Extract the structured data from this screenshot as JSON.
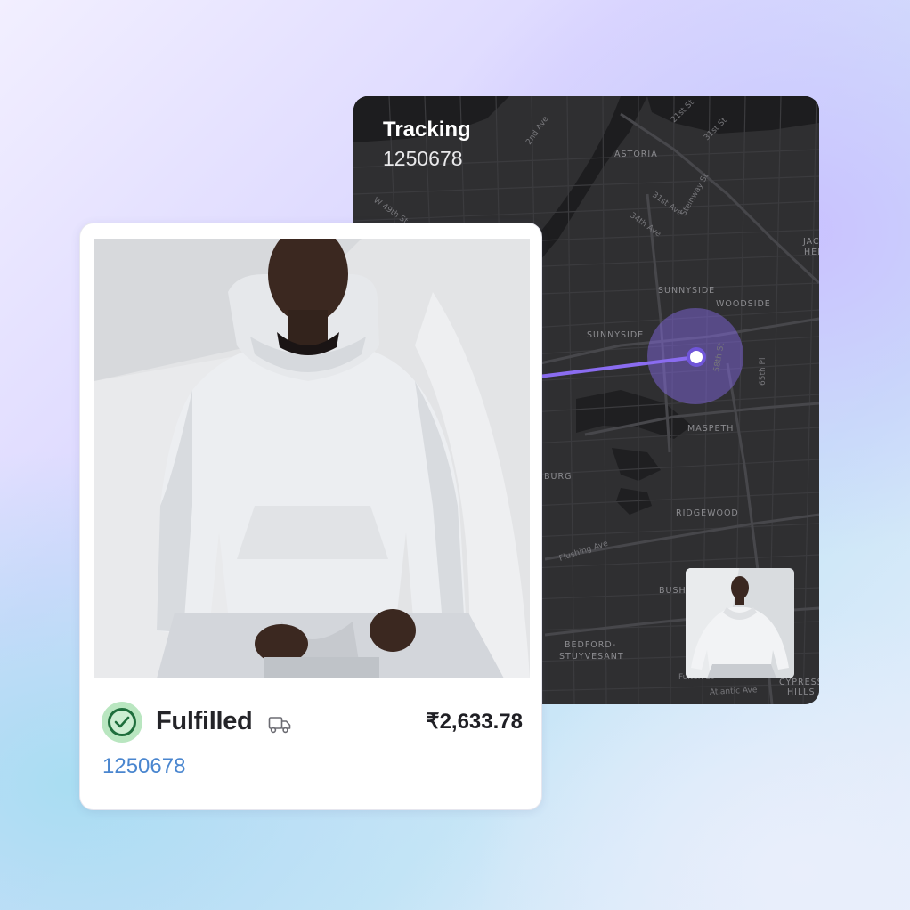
{
  "tracking": {
    "title": "Tracking",
    "number": "1250678"
  },
  "map": {
    "neighborhoods": [
      {
        "label": "ASTORIA"
      },
      {
        "label": "SUNNYSIDE"
      },
      {
        "label": "WOODSIDE"
      },
      {
        "label": "SUNNYSIDE"
      },
      {
        "label": "MASPETH"
      },
      {
        "label": "RIDGEWOOD"
      },
      {
        "label": "BURG"
      },
      {
        "label": "BEDFORD-"
      },
      {
        "label": "STUYVESANT"
      },
      {
        "label": "CYPRESS"
      },
      {
        "label": "HILLS"
      },
      {
        "label": "JAC"
      },
      {
        "label": "HEI"
      },
      {
        "label": "BUSH"
      }
    ],
    "streets": [
      {
        "label": "21st St"
      },
      {
        "label": "31st St"
      },
      {
        "label": "2nd Ave"
      },
      {
        "label": "31st Ave"
      },
      {
        "label": "Steinway St"
      },
      {
        "label": "34th Ave"
      },
      {
        "label": "58th St"
      },
      {
        "label": "65th Pl"
      },
      {
        "label": "Flushing Ave"
      },
      {
        "label": "Atlantic Ave"
      },
      {
        "label": "Fulton St"
      },
      {
        "label": "W 49th St"
      }
    ],
    "accent_color": "#8a6cf0",
    "marker_color": "#6f55d9"
  },
  "order": {
    "status": "Fulfilled",
    "status_color": "#1f6e3c",
    "price": "₹2,633.78",
    "order_number": "1250678",
    "link_color": "#4a86cf",
    "icons": {
      "status": "check-circle-icon",
      "shipping": "truck-icon"
    }
  }
}
